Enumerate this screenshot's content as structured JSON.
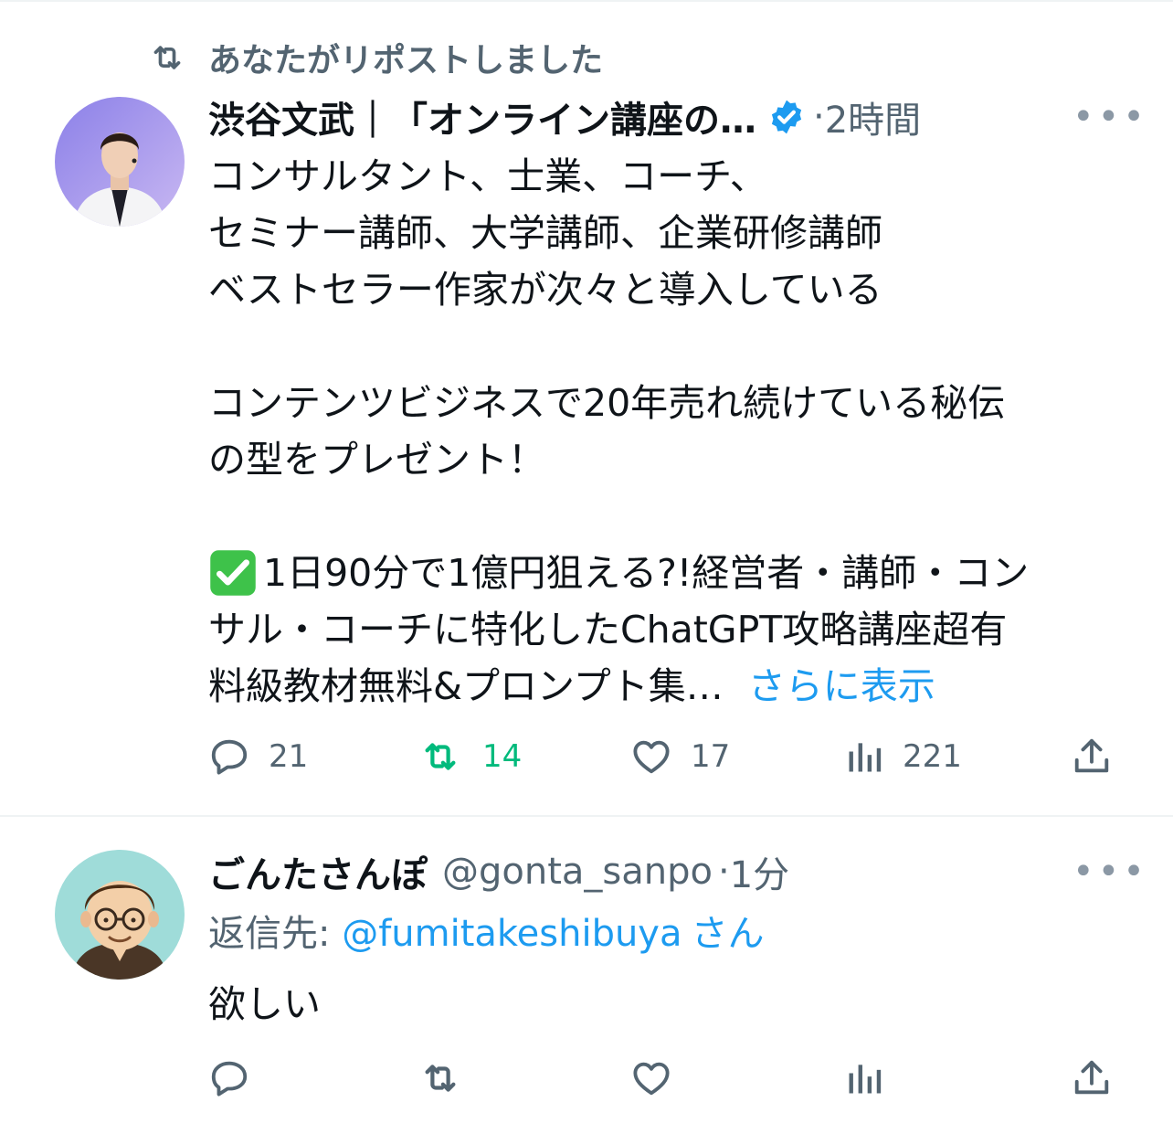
{
  "repost_banner": {
    "text": "あなたがリポストしました"
  },
  "tweet1": {
    "author_name": "渋谷文武｜「オンライン講座の…",
    "time": "2時間",
    "more_label": "•••",
    "lines": [
      "コンサルタント、士業、コーチ、",
      "セミナー講師、大学講師、企業研修講師",
      "ベストセラー作家が次々と導入している",
      "",
      "コンテンツビジネスで20年売れ続けている秘伝",
      "の型をプレゼント！",
      "",
      "1日90分で1億円狙える?!経営者・講師・コン",
      "サル・コーチに特化したChatGPT攻略講座超有",
      "料級教材無料&プロンプト集…"
    ],
    "show_more": "さらに表示",
    "counts": {
      "replies": "21",
      "reposts": "14",
      "likes": "17",
      "views": "221"
    }
  },
  "tweet2": {
    "author_name": "ごんたさんぽ",
    "handle": "@gonta_sanpo",
    "time": "1分",
    "more_label": "•••",
    "reply_to_label": "返信先: ",
    "reply_to_handle": "@fumitakeshibuya",
    "reply_to_suffix": "さん",
    "text": "欲しい"
  },
  "colors": {
    "accent": "#1d9bf0",
    "repost_green": "#00ba7c",
    "muted": "#536471",
    "verified": "#1d9bf0"
  },
  "icons": [
    "repost-icon",
    "verified-badge-icon",
    "reply-icon",
    "like-icon",
    "views-icon",
    "share-icon",
    "checkmark-emoji-icon"
  ]
}
